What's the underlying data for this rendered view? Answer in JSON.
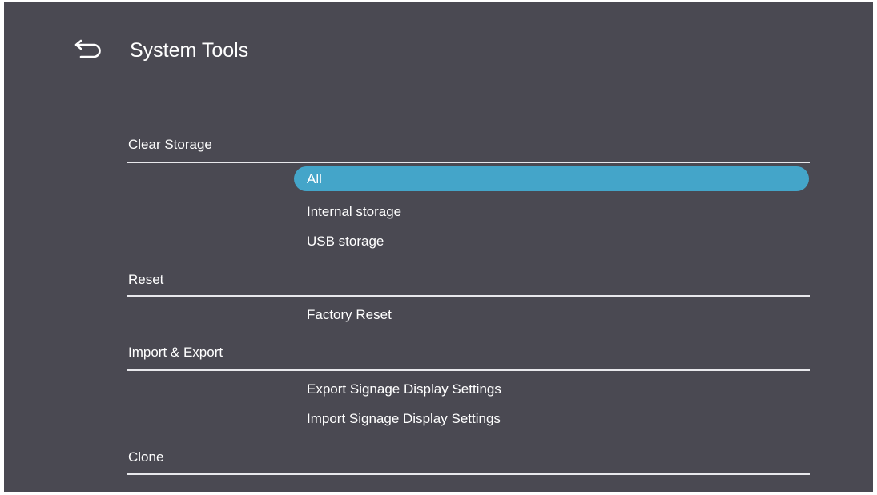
{
  "header": {
    "title": "System Tools",
    "back_icon": "back-arrow-icon"
  },
  "colors": {
    "background": "#4a4952",
    "highlight": "#44a5c9",
    "divider": "#e8e8ec",
    "text": "#ffffff"
  },
  "sections": [
    {
      "header": "Clear Storage",
      "options": [
        "All",
        "Internal storage",
        "USB storage"
      ],
      "selected": "All"
    },
    {
      "header": "Reset",
      "options": [
        "Factory Reset"
      ]
    },
    {
      "header": "Import & Export",
      "options": [
        "Export Signage Display Settings",
        "Import Signage Display Settings"
      ]
    },
    {
      "header": "Clone",
      "options": []
    }
  ]
}
